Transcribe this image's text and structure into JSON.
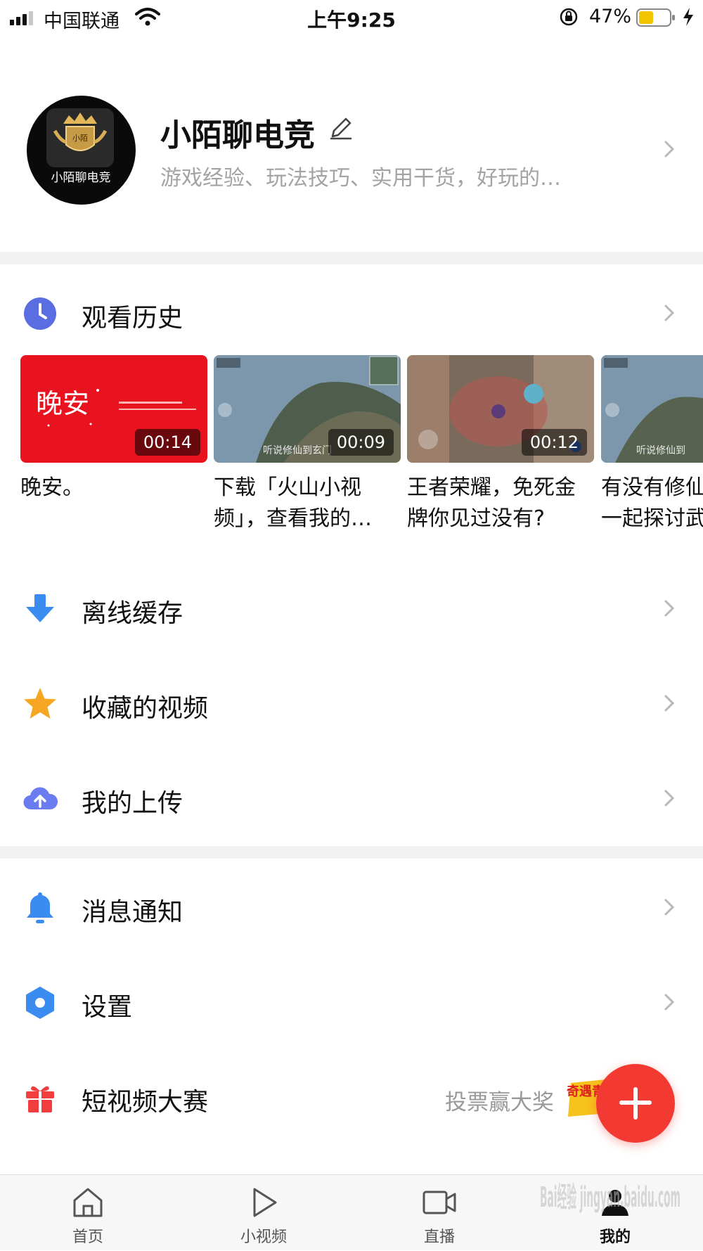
{
  "status_bar": {
    "carrier": "中国联通",
    "time": "上午9:25",
    "battery_percent": "47%",
    "battery_level": 0.47
  },
  "profile": {
    "avatar_text": "小陌聊电竞",
    "avatar_crest_text": "小陌",
    "name": "小陌聊电竞",
    "bio": "游戏经验、玩法技巧、实用干货，好玩的…"
  },
  "history": {
    "label": "观看历史",
    "items": [
      {
        "title_line1": "晚安。",
        "title_line2": "",
        "duration": "00:14",
        "thumb_text": "晚安"
      },
      {
        "title_line1": "下载「火山小视",
        "title_line2": "频」，查看我的…",
        "duration": "00:09",
        "thumb_text": "听说修仙到玄门"
      },
      {
        "title_line1": "王者荣耀，免死金",
        "title_line2": "牌你见过没有?",
        "duration": "00:12",
        "thumb_text": ""
      },
      {
        "title_line1": "有没有修仙",
        "title_line2": "一起探讨武",
        "duration": "",
        "thumb_text": "听说修仙到"
      }
    ]
  },
  "menu": {
    "offline": "离线缓存",
    "favorites": "收藏的视频",
    "uploads": "我的上传",
    "notifications": "消息通知",
    "settings": "设置",
    "contest": "短视频大赛",
    "contest_extra": "投票赢大奖"
  },
  "promo_badge_text": "奇遇青年",
  "tabs": [
    {
      "label": "首页",
      "icon": "home-icon"
    },
    {
      "label": "小视频",
      "icon": "play-icon"
    },
    {
      "label": "直播",
      "icon": "video-camera-icon"
    },
    {
      "label": "我的",
      "icon": "user-icon"
    }
  ],
  "watermark": "Bai经验 jingyan.baidu.com",
  "colors": {
    "accent_red": "#f23a33",
    "history_icon": "#5b6ee1",
    "download_icon": "#3b8cf0",
    "star_icon": "#f6a623",
    "upload_icon": "#6b7cf0",
    "bell_icon": "#3b8cf0",
    "settings_icon": "#3b8cf0",
    "gift_icon": "#f03e3e"
  }
}
